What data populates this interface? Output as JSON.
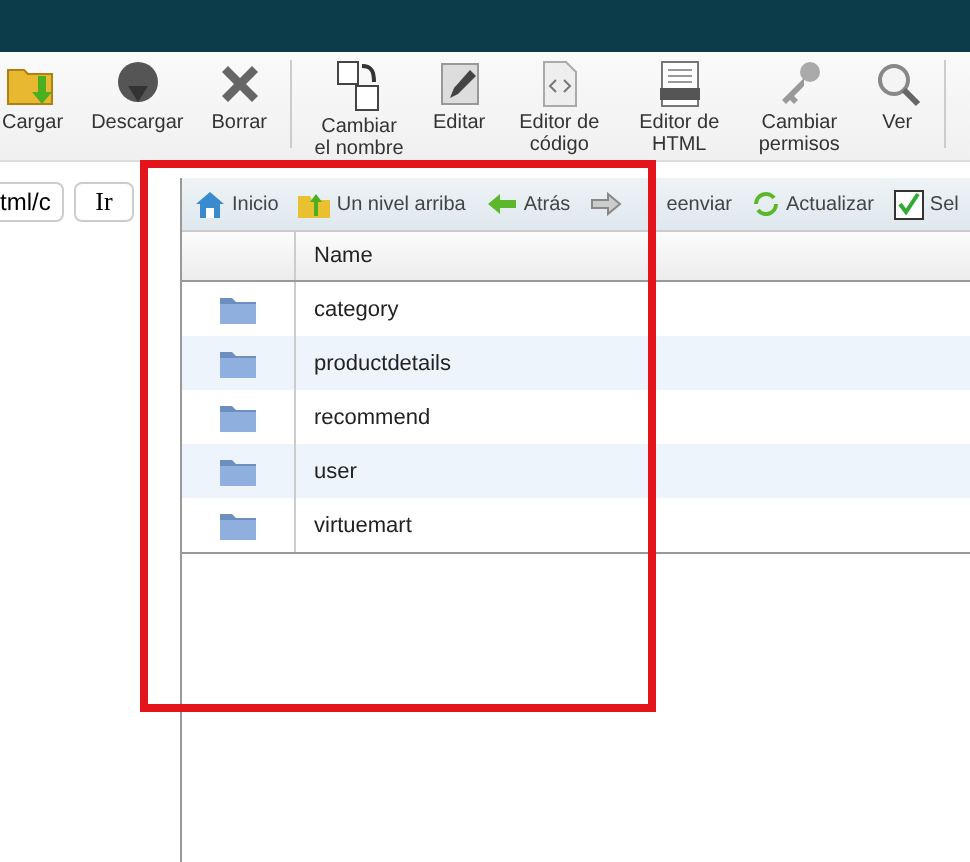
{
  "toolbar": [
    [
      {
        "label": "Cargar",
        "kind": "upload"
      },
      {
        "label": "Descargar",
        "kind": "download"
      },
      {
        "label": "Borrar",
        "kind": "delete"
      }
    ],
    [
      {
        "label": "Cambiar el nombre",
        "kind": "rename"
      },
      {
        "label": "Editar",
        "kind": "edit"
      },
      {
        "label": "Editor de código",
        "kind": "code"
      },
      {
        "label": "Editor de HTML",
        "kind": "html"
      },
      {
        "label": "Cambiar permisos",
        "kind": "permissions"
      },
      {
        "label": "Ver",
        "kind": "view"
      }
    ]
  ],
  "path": {
    "value": "tml/c",
    "button": "Ir"
  },
  "nav": [
    {
      "label": "Inicio",
      "kind": "home"
    },
    {
      "label": "Un nivel arriba",
      "kind": "up"
    },
    {
      "label": "Atrás",
      "kind": "back"
    },
    {
      "label": "eenviar",
      "kind": "forward"
    },
    {
      "label": "Actualizar",
      "kind": "refresh"
    },
    {
      "label": "Sel",
      "kind": "select"
    }
  ],
  "table": {
    "columns": [
      "Name"
    ],
    "rows": [
      {
        "name": "category"
      },
      {
        "name": "productdetails"
      },
      {
        "name": "recommend"
      },
      {
        "name": "user"
      },
      {
        "name": "virtuemart"
      }
    ]
  }
}
